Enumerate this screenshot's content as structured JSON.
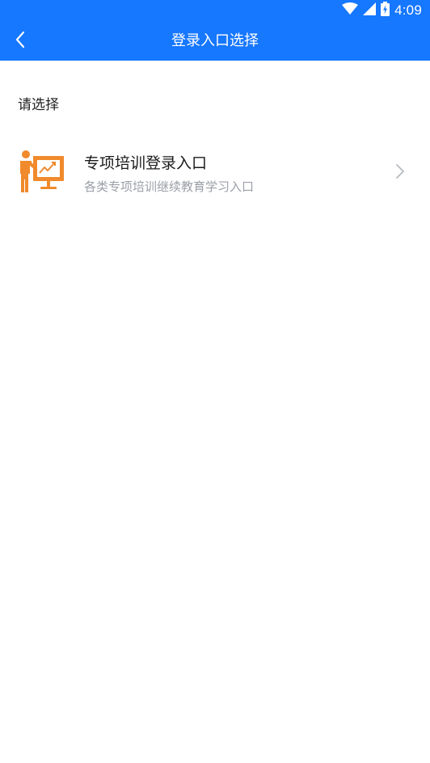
{
  "status_bar": {
    "time": "4:09",
    "icons": [
      "wifi-icon",
      "cellular-signal-icon",
      "battery-charging-icon"
    ]
  },
  "app_bar": {
    "title": "登录入口选择",
    "back_icon": "chevron-left-icon"
  },
  "prompt": "请选择",
  "entries": [
    {
      "title": "专项培训登录入口",
      "subtitle": "各类专项培训继续教育学习入口",
      "icon": "teacher-presentation-icon",
      "chevron_icon": "chevron-right-icon"
    }
  ],
  "colors": {
    "primary": "#1677ff",
    "icon_accent": "#f08a2c",
    "title_text": "#1a1a1a",
    "subtitle_text": "#9a9fa8",
    "chevron": "#b5b9c0"
  }
}
